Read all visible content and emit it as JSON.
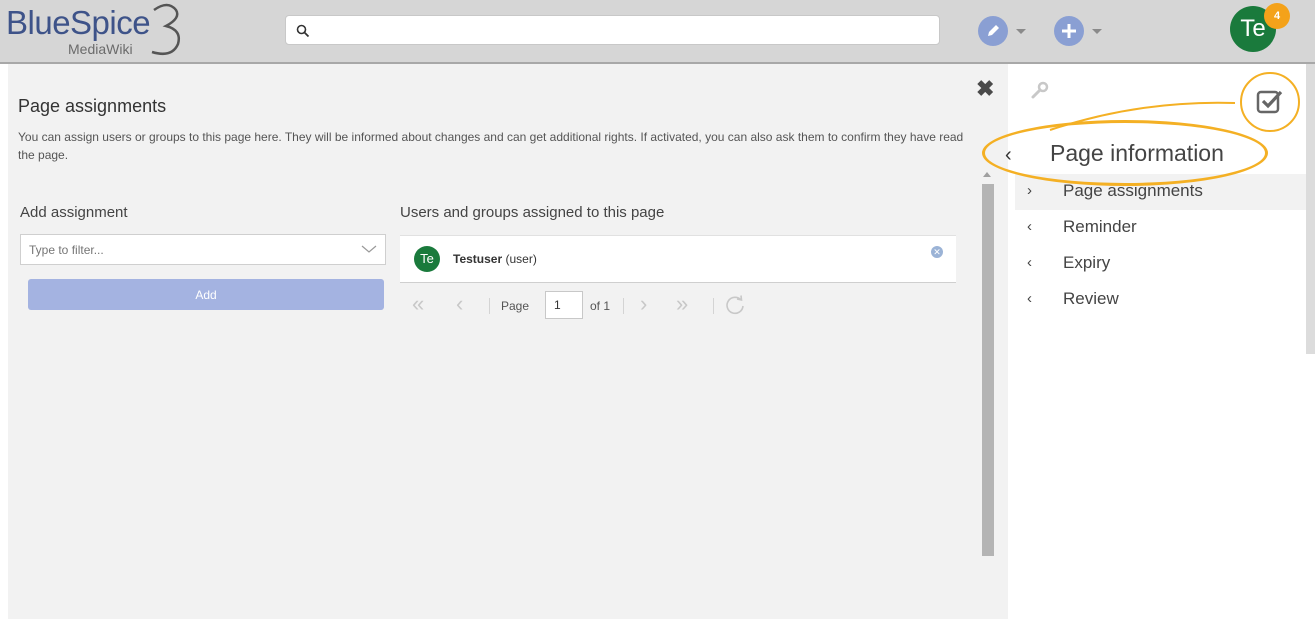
{
  "header": {
    "logo_text": "BlueSpice",
    "logo_sub": "MediaWiki",
    "logo_number": "3",
    "search_placeholder": "",
    "user_initials": "Te",
    "notification_count": "4"
  },
  "dialog": {
    "title": "Page assignments",
    "description": "You can assign users or groups to this page here. They will be informed about changes and can get additional rights. If activated, you can also ask them to confirm they have read the page.",
    "add_heading": "Add assignment",
    "filter_placeholder": "Type to filter...",
    "add_button": "Add",
    "assigned_heading": "Users and groups assigned to this page",
    "assigned": [
      {
        "initials": "Te",
        "name": "Testuser",
        "type": "(user)"
      }
    ],
    "pager": {
      "page_label": "Page",
      "current_page": "1",
      "of_label": "of 1"
    }
  },
  "flyout": {
    "title": "Page information",
    "items": [
      {
        "label": "Page assignments",
        "chevron": "›"
      },
      {
        "label": "Reminder",
        "chevron": "‹"
      },
      {
        "label": "Expiry",
        "chevron": "‹"
      },
      {
        "label": "Review",
        "chevron": "‹"
      }
    ]
  },
  "colors": {
    "accent": "#8a9fd3",
    "avatar": "#1a7a3c",
    "badge": "#f4a21a",
    "annotation": "#f4b024"
  }
}
